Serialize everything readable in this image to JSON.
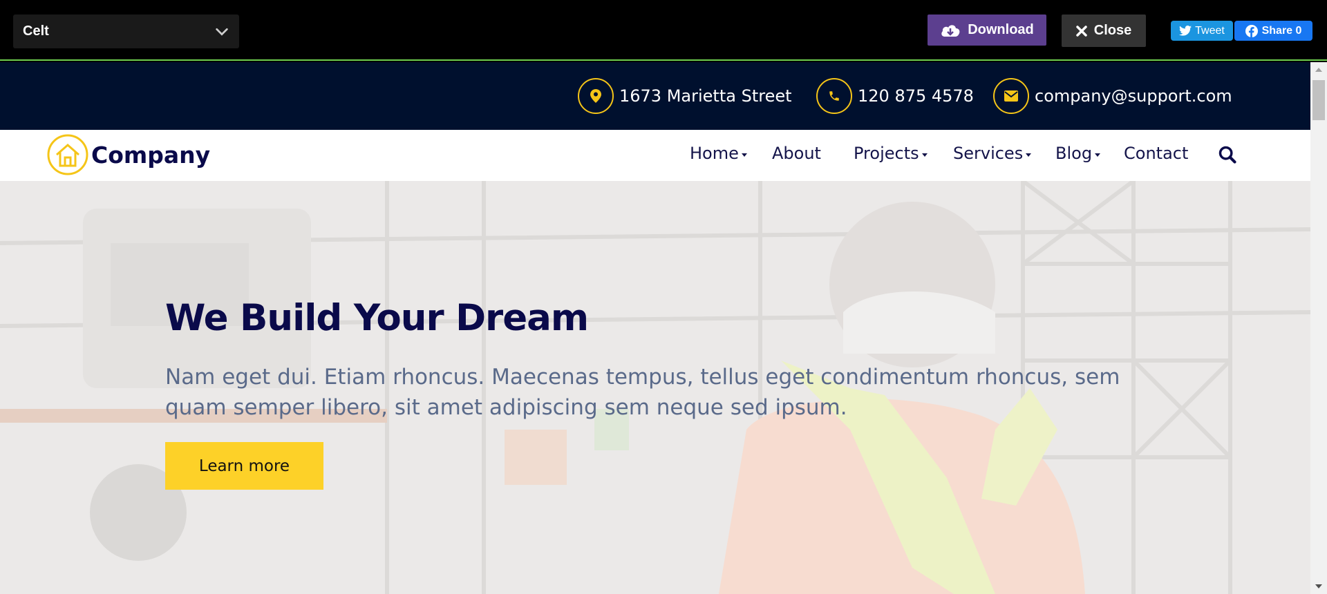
{
  "preview_bar": {
    "theme_select_value": "Celt",
    "download_label": "Download",
    "close_label": "Close",
    "tweet_label": "Tweet",
    "share_label": "Share 0"
  },
  "topbar": {
    "address": "1673 Marietta Street",
    "phone": "120 875 4578",
    "email": "company@support.com"
  },
  "navbar": {
    "logo_text": "Company",
    "items": [
      {
        "label": "Home",
        "dropdown": true
      },
      {
        "label": "About",
        "dropdown": false
      },
      {
        "label": "Projects",
        "dropdown": true
      },
      {
        "label": "Services",
        "dropdown": true
      },
      {
        "label": "Blog",
        "dropdown": true
      },
      {
        "label": "Contact",
        "dropdown": false
      }
    ]
  },
  "hero": {
    "title": "We Build Your Dream",
    "text": "Nam eget dui. Etiam rhoncus. Maecenas tempus, tellus eget condimentum rhoncus, sem quam semper libero, sit amet adipiscing sem neque sed ipsum.",
    "button_label": "Learn more"
  },
  "colors": {
    "accent_yellow": "#fdd128",
    "topbar_navy": "#00102e",
    "download_purple": "#5c3f8f",
    "tweet_blue": "#1b95e0",
    "facebook_blue": "#1877f2"
  }
}
